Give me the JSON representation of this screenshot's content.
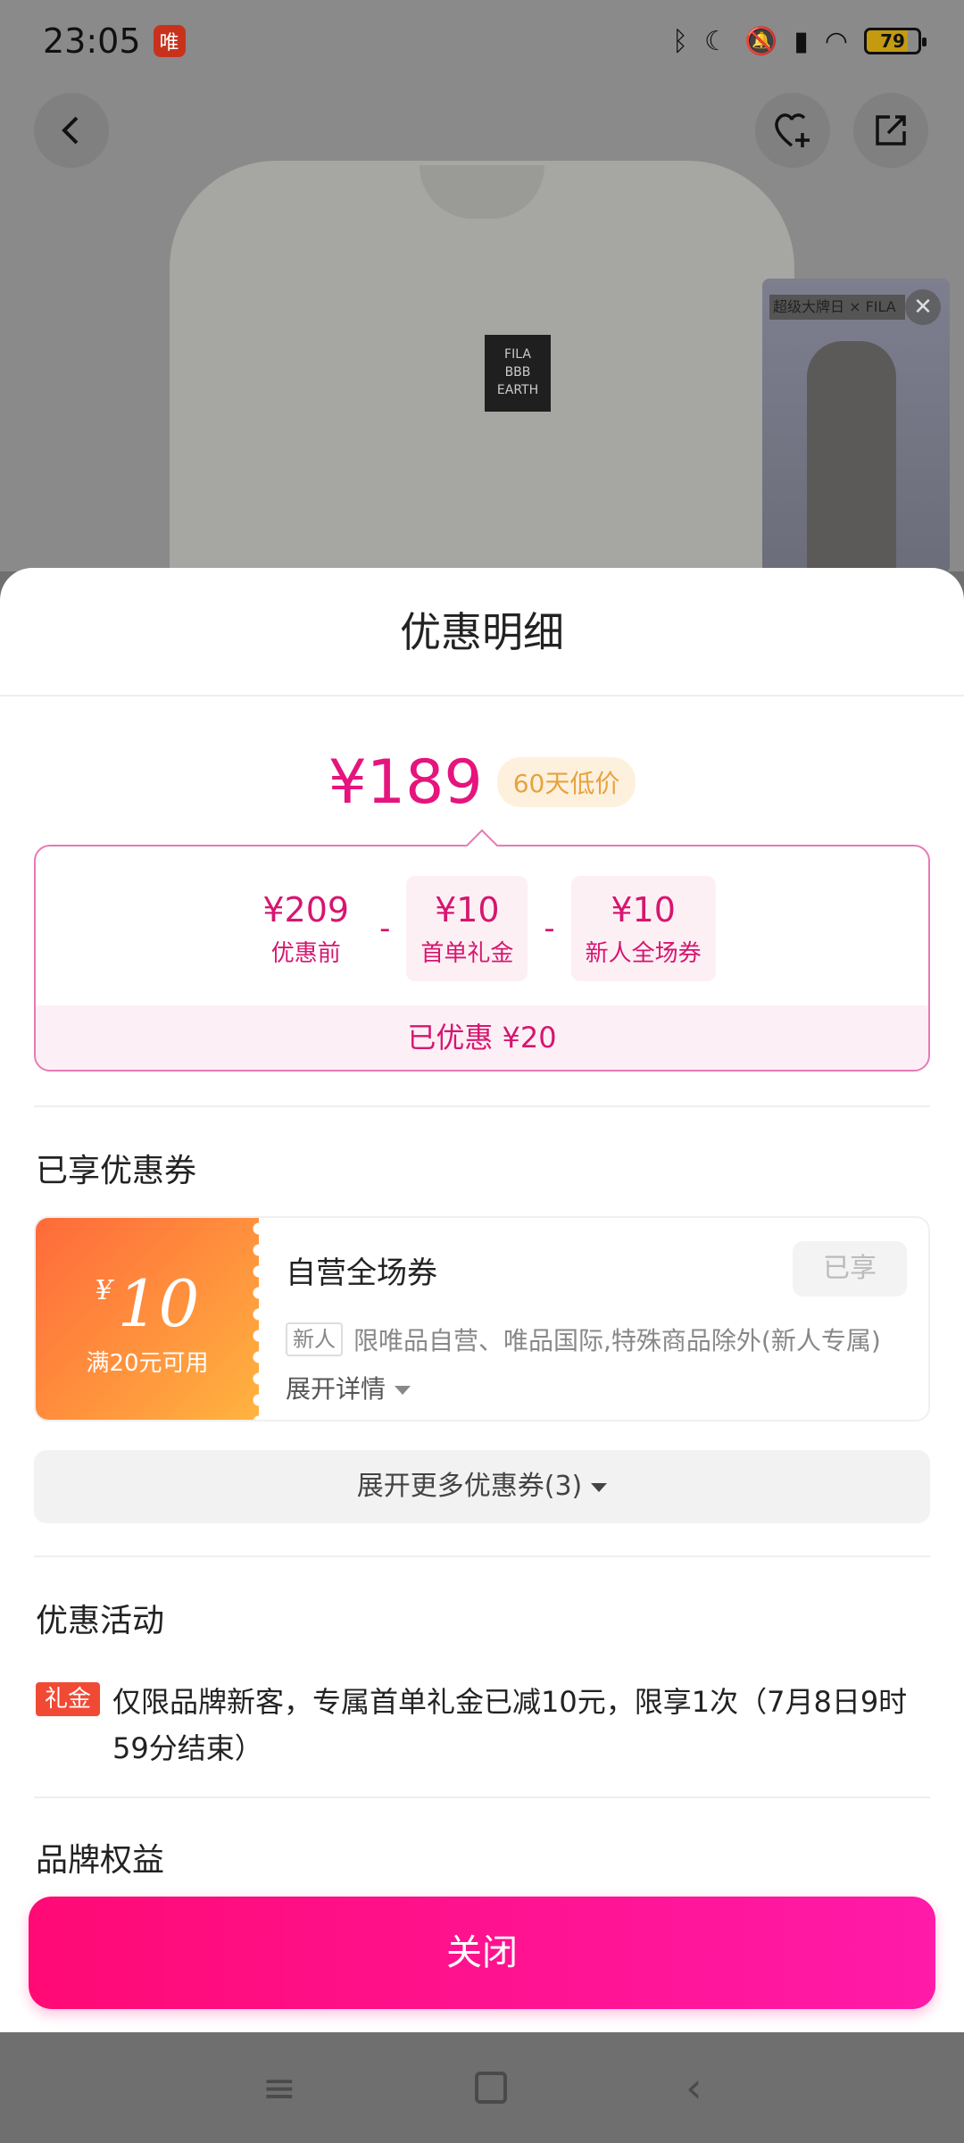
{
  "status_bar": {
    "time": "23:05",
    "app_badge": "唯",
    "battery": "79",
    "icons": [
      "bluetooth-icon",
      "moon-icon",
      "mute-icon",
      "signal-icon",
      "wifi-icon"
    ]
  },
  "product_page": {
    "shirt_label_line1": "FILA",
    "shirt_label_line2": "BBB EARTH",
    "video_title": "超级大牌日 × FILA"
  },
  "sheet": {
    "title": "优惠明细",
    "final_price": "¥189",
    "low_price_tag": "60天低价",
    "breakdown": {
      "items": [
        {
          "amount": "¥209",
          "label": "优惠前"
        },
        {
          "amount": "¥10",
          "label": "首单礼金"
        },
        {
          "amount": "¥10",
          "label": "新人全场券"
        }
      ],
      "minus": "-",
      "saved": "已优惠 ¥20"
    },
    "coupons_section": {
      "title": "已享优惠券",
      "coupon": {
        "currency": "¥",
        "amount": "10",
        "condition": "满20元可用",
        "name": "自营全场券",
        "status": "已享",
        "tag": "新人",
        "desc": "限唯品自营、唯品国际,特殊商品除外(新人专属)",
        "expand": "展开详情"
      },
      "more": "展开更多优惠券(3)"
    },
    "activity_section": {
      "title": "优惠活动",
      "tag": "礼金",
      "text": "仅限品牌新客，专属首单礼金已减10元，限享1次（7月8日9时59分结束）"
    },
    "brand_section": {
      "title": "品牌权益"
    },
    "close_button": "关闭"
  },
  "colors": {
    "accent": "#e6147d",
    "close_gradient_start": "#ff0a75",
    "close_gradient_end": "#ff1aa8",
    "coupon_orange": "#ff6a3a"
  }
}
